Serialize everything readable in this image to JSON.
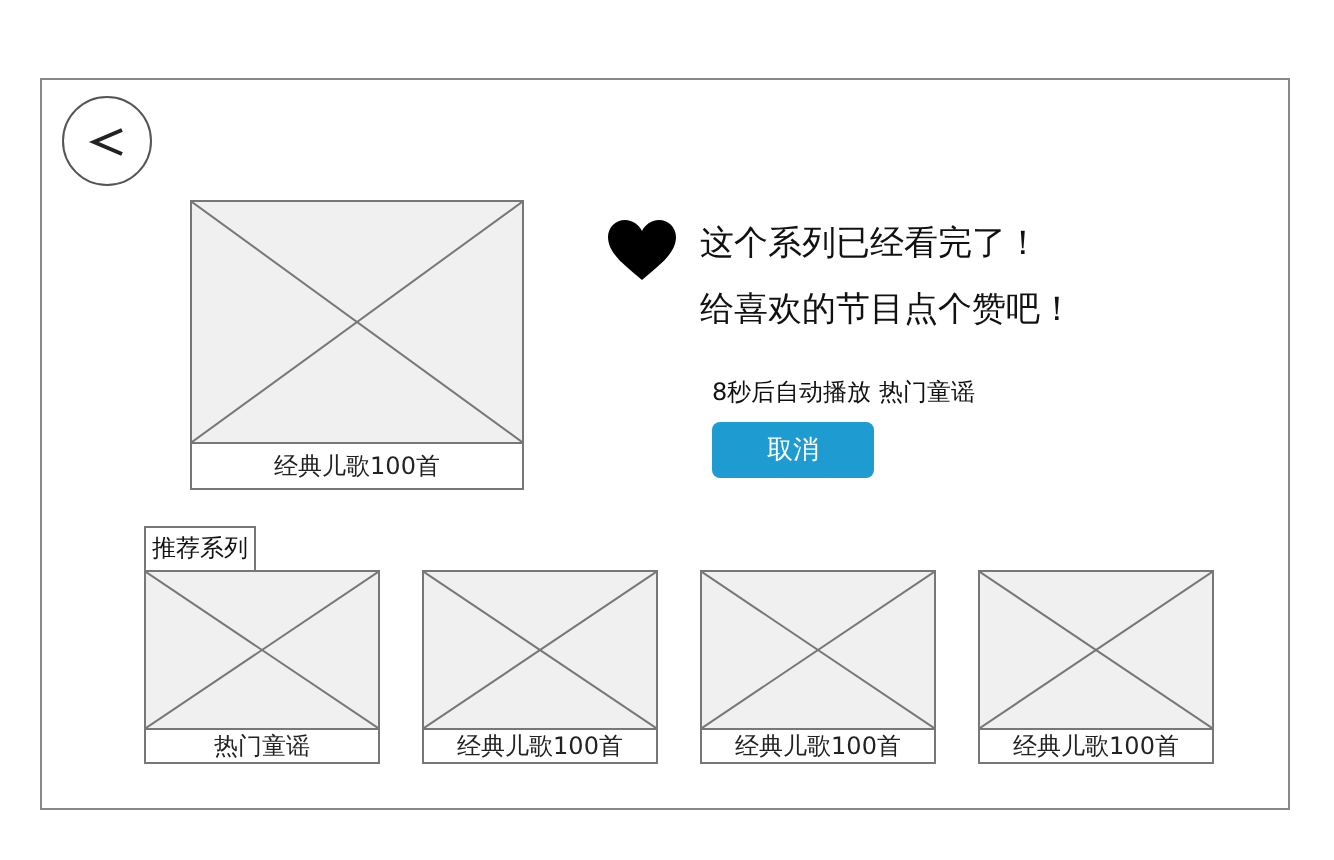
{
  "featured": {
    "caption": "经典儿歌100首"
  },
  "message": [
    "这个系列已经看完了！",
    "给喜欢的节目点个赞吧！"
  ],
  "autoplay_notice": "8秒后自动播放 热门童谣",
  "cancel_button": "取消",
  "recommended": {
    "title": "推荐系列",
    "items": [
      {
        "caption": "热门童谣"
      },
      {
        "caption": "经典儿歌100首"
      },
      {
        "caption": "经典儿歌100首"
      },
      {
        "caption": "经典儿歌100首"
      }
    ]
  }
}
